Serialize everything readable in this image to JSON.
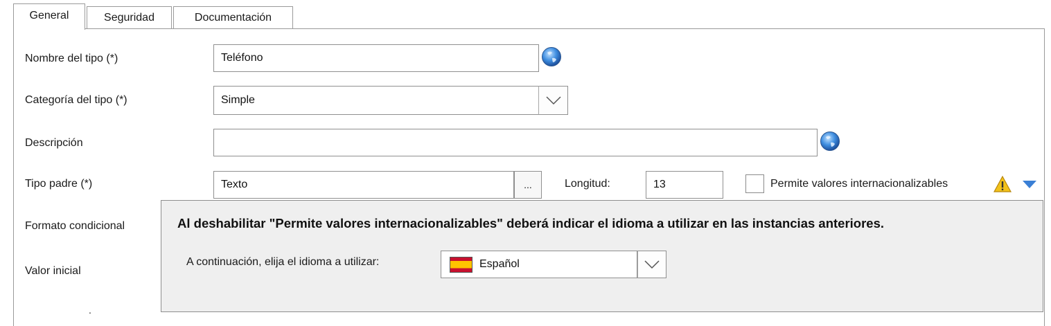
{
  "tabs": [
    {
      "label": "General",
      "active": true
    },
    {
      "label": "Seguridad",
      "active": false
    },
    {
      "label": "Documentación",
      "active": false
    }
  ],
  "form": {
    "nombre": {
      "label": "Nombre del tipo (*)",
      "value": "Teléfono"
    },
    "categoria": {
      "label": "Categoría del tipo (*)",
      "value": "Simple"
    },
    "descripcion": {
      "label": "Descripción",
      "value": ""
    },
    "tipo_padre": {
      "label": "Tipo padre (*)",
      "value": "Texto",
      "browse_label": "..."
    },
    "longitud": {
      "label": "Longitud:",
      "value": "13"
    },
    "internacionalizables": {
      "label": "Permite valores internacionalizables",
      "checked": false
    },
    "formato": {
      "label": "Formato condicional"
    },
    "valor_inicial": {
      "label": "Valor inicial"
    },
    "cutoff_text": "."
  },
  "popup": {
    "message": "Al deshabilitar \"Permite valores internacionalizables\" deberá indicar el idioma a utilizar en las instancias anteriores.",
    "prompt": "A continuación, elija el idioma a utilizar:",
    "language": "Español"
  },
  "icons": {
    "globe": "globe-icon",
    "warning": "warning-icon",
    "triangle": "triangle-down-icon",
    "flag": "spain-flag-icon"
  },
  "colors": {
    "warning": "#f2c21a",
    "triangle": "#3a7fd5",
    "globe": "#2a6fd0",
    "popup_bg": "#efefef",
    "flag_red": "#c8102e",
    "flag_yellow": "#ffc400"
  }
}
